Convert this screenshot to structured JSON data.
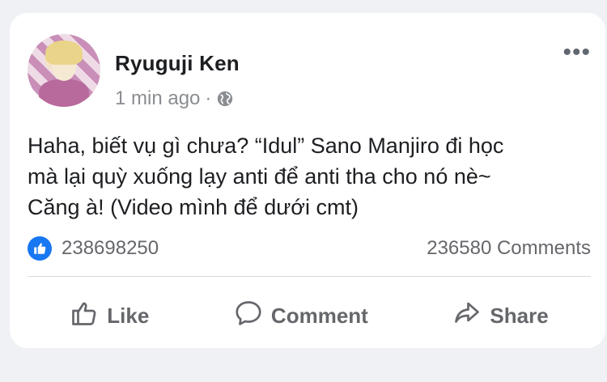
{
  "post": {
    "author": "Ryuguji Ken",
    "time": "1 min ago",
    "separator": "·",
    "privacy_icon": "globe-icon",
    "more_icon": "•••",
    "text_lines": [
      "Haha, biết vụ gì chưa? “Idul” Sano Manjiro đi học",
      "mà lại quỳ xuống lạy anti để anti tha cho nó nè~",
      "Căng à! (Video mình để dưới cmt)"
    ]
  },
  "stats": {
    "reaction_icon": "like-icon",
    "like_count": "238698250",
    "comment_count": "236580 Comments"
  },
  "actions": {
    "like": "Like",
    "comment": "Comment",
    "share": "Share"
  },
  "colors": {
    "accent": "#1877f2",
    "text": "#1c1e21",
    "muted": "#65676b",
    "background": "#f0f1f5"
  }
}
